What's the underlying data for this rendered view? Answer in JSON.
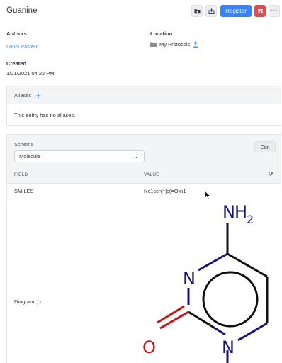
{
  "entity": {
    "title": "Guanine"
  },
  "toolbar": {
    "register_label": "Register",
    "more_label": "⋯"
  },
  "authors": {
    "label": "Authors",
    "value": "Louis Pasteur"
  },
  "location": {
    "label": "Location",
    "value": "My Protocols"
  },
  "created": {
    "label": "Created",
    "value": "1/21/2021 04:22 PM"
  },
  "aliases": {
    "title": "Aliases",
    "empty_text": "This entity has no aliases."
  },
  "schema": {
    "label": "Schema",
    "selected": "Molecule",
    "edit_label": "Edit",
    "columns": {
      "field": "FIELD",
      "value": "VALUE"
    },
    "rows": [
      {
        "field": "SMILES",
        "value": "Nc1ccn[*]c(=O)n1"
      }
    ],
    "diagram": {
      "label": "Diagram",
      "atoms": {
        "amine_n": "N",
        "amine_h": "H",
        "amine_sub": "2",
        "ring_n1": "N",
        "ring_n2": "N",
        "oxygen": "O"
      }
    }
  },
  "colors": {
    "accent": "#3b82f6",
    "danger": "#e5484d",
    "bond_n": "#14147a",
    "bond_o": "#cc1111"
  }
}
